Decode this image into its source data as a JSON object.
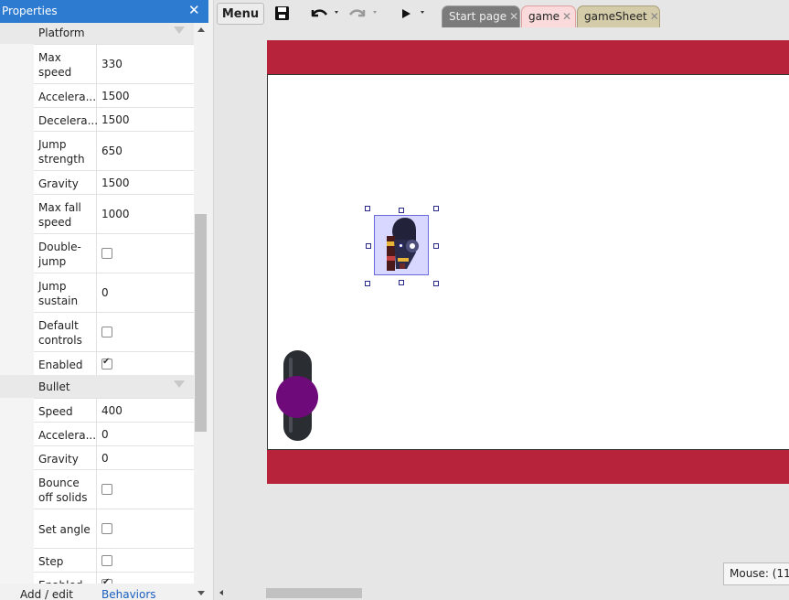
{
  "properties_panel": {
    "title": "Properties",
    "close_glyph": "✕",
    "sections": [
      {
        "name": "Platform",
        "rows": [
          {
            "label": "Max speed",
            "type": "text",
            "value": "330"
          },
          {
            "label": "Accelera...",
            "type": "text",
            "value": "1500"
          },
          {
            "label": "Decelera...",
            "type": "text",
            "value": "1500"
          },
          {
            "label": "Jump strength",
            "type": "text",
            "value": "650"
          },
          {
            "label": "Gravity",
            "type": "text",
            "value": "1500"
          },
          {
            "label": "Max fall speed",
            "type": "text",
            "value": "1000"
          },
          {
            "label": "Double-jump",
            "type": "checkbox",
            "checked": false
          },
          {
            "label": "Jump sustain",
            "type": "text",
            "value": "0"
          },
          {
            "label": "Default controls",
            "type": "checkbox",
            "checked": false
          },
          {
            "label": "Enabled",
            "type": "checkbox",
            "checked": true
          }
        ]
      },
      {
        "name": "Bullet",
        "rows": [
          {
            "label": "Speed",
            "type": "text",
            "value": "400"
          },
          {
            "label": "Accelera...",
            "type": "text",
            "value": "0"
          },
          {
            "label": "Gravity",
            "type": "text",
            "value": "0"
          },
          {
            "label": "Bounce off solids",
            "type": "checkbox",
            "checked": false
          },
          {
            "label": "Set angle",
            "type": "checkbox",
            "checked": false
          },
          {
            "label": "Step",
            "type": "checkbox",
            "checked": false
          },
          {
            "label": "Enabled",
            "type": "checkbox",
            "checked": true
          }
        ]
      }
    ],
    "footer": {
      "label": "Add / edit",
      "link": "Behaviors"
    }
  },
  "toolbar": {
    "menu_label": "Menu",
    "icons": [
      "save-icon",
      "undo-icon",
      "redo-icon",
      "play-icon"
    ]
  },
  "tabs": [
    {
      "label": "Start page",
      "close": "✕",
      "active": false
    },
    {
      "label": "game",
      "close": "✕",
      "active": true
    },
    {
      "label": "gameSheet",
      "close": "✕",
      "active": false
    }
  ],
  "status": {
    "mouse": "Mouse: (11"
  },
  "colors": {
    "panel_header": "#2d7bd0",
    "layout_bar": "#b7233b",
    "joystick_knob": "#6e0a7a",
    "link": "#1a5fbf"
  }
}
